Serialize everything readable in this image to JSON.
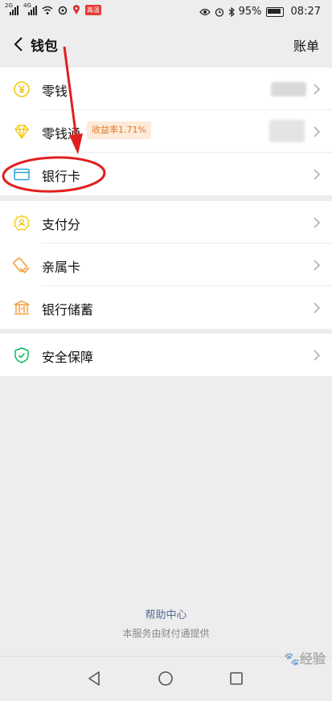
{
  "status_bar": {
    "sig1_tag": "2G",
    "sig2_tag": "4G",
    "badge": "高温",
    "battery": "95%",
    "time": "08:27"
  },
  "header": {
    "title": "钱包",
    "bills": "账单"
  },
  "groups": [
    {
      "items": [
        {
          "label": "零钱",
          "icon": "coin-yuan-icon"
        },
        {
          "label": "零钱通",
          "icon": "diamond-icon",
          "badge": "收益率1.71%"
        },
        {
          "label": "银行卡",
          "icon": "bank-card-icon"
        }
      ]
    },
    {
      "items": [
        {
          "label": "支付分",
          "icon": "pay-score-icon"
        },
        {
          "label": "亲属卡",
          "icon": "family-card-icon"
        },
        {
          "label": "银行储蓄",
          "icon": "bank-building-icon"
        }
      ]
    },
    {
      "items": [
        {
          "label": "安全保障",
          "icon": "shield-check-icon"
        }
      ]
    }
  ],
  "footer": {
    "help": "帮助中心",
    "powered_by": "本服务由财付通提供"
  },
  "watermark": "经验",
  "colors": {
    "accent_yellow": "#f2c811",
    "accent_orange": "#f29a38",
    "accent_blue": "#2aa1db",
    "accent_green": "#07c160",
    "annotation_red": "#e02020",
    "link_blue": "#576b95"
  }
}
